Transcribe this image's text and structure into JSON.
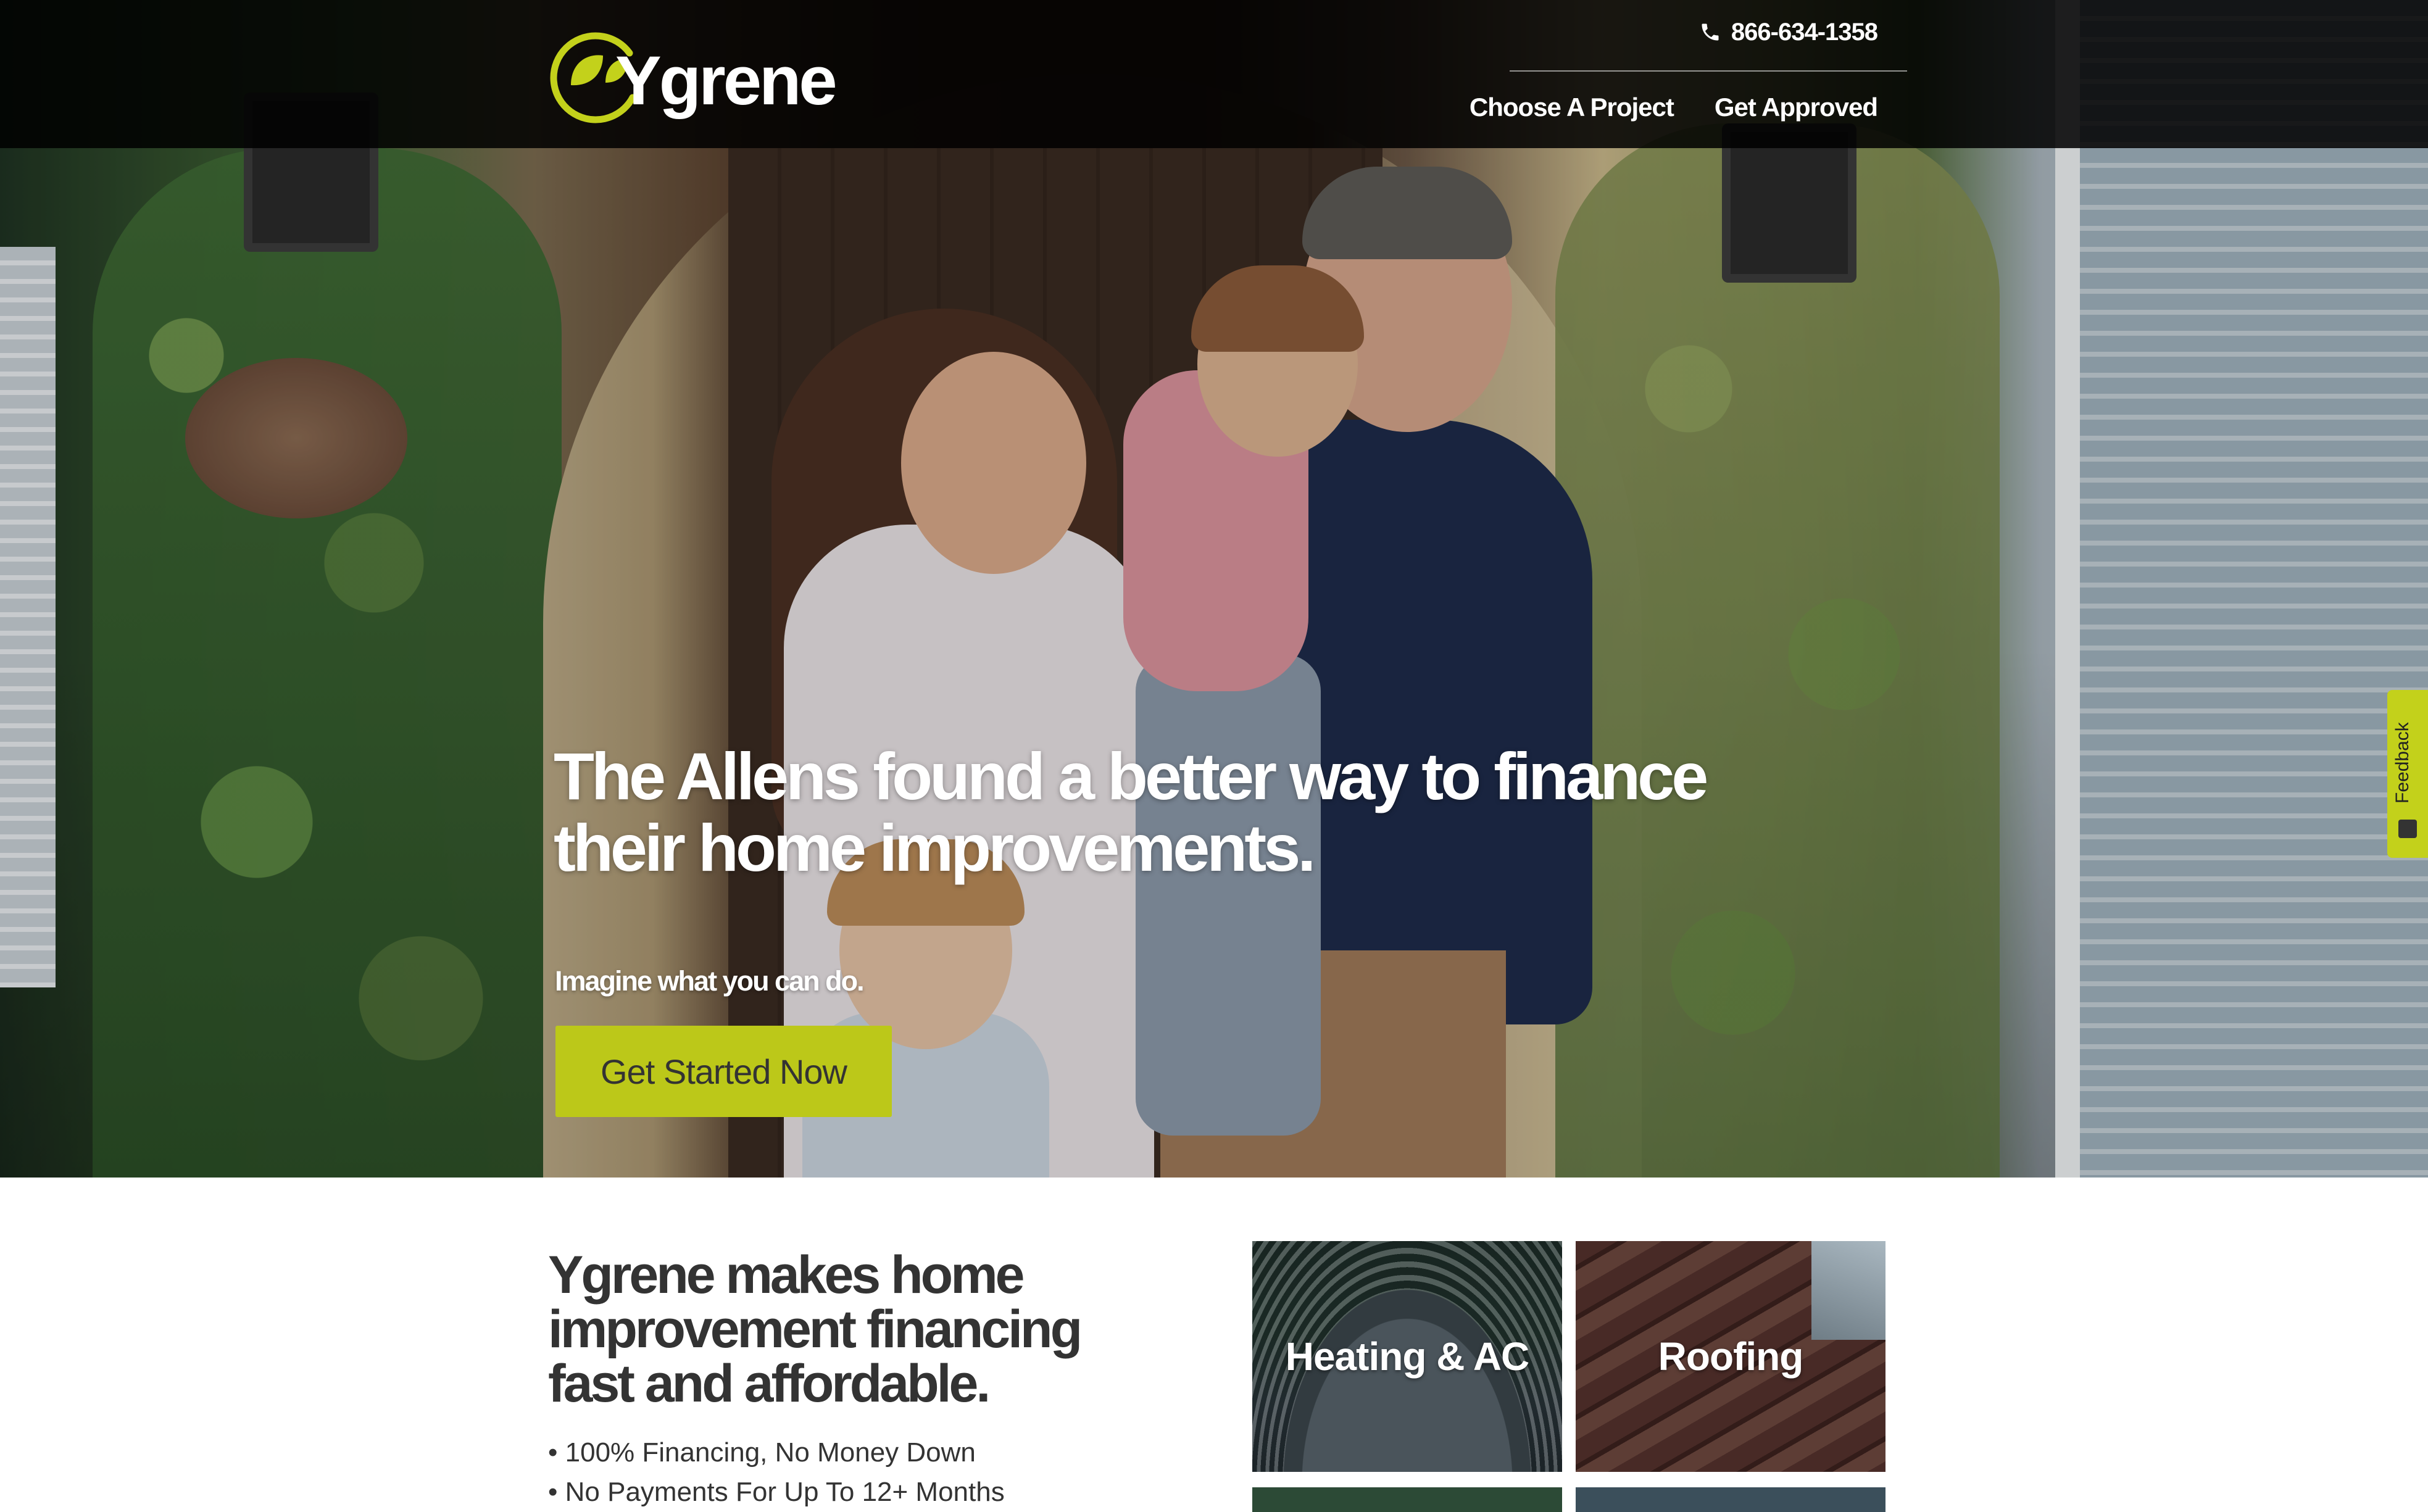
{
  "header": {
    "logo_text": "Ygrene",
    "phone": "866-634-1358",
    "nav": [
      {
        "label": "Choose A Project"
      },
      {
        "label": "Get Approved"
      }
    ]
  },
  "hero": {
    "headline": "The Allens found a better way to finance their home improvements.",
    "subline": "Imagine what you can do.",
    "cta_label": "Get Started Now"
  },
  "feedback": {
    "label": "Feedback"
  },
  "intro": {
    "title": "Ygrene makes home improvement financing fast and affordable.",
    "bullets": [
      "100% Financing, No Money Down",
      "No Payments For Up To 12+ Months"
    ]
  },
  "projects": [
    {
      "label": "Heating & AC"
    },
    {
      "label": "Roofing"
    }
  ],
  "colors": {
    "brand_green": "#bcc819",
    "header_bg": "#000000",
    "text_dark": "#333333"
  },
  "icons": {
    "logo": "leaf-logo-icon",
    "phone": "phone-icon",
    "feedback": "chat-icon"
  }
}
